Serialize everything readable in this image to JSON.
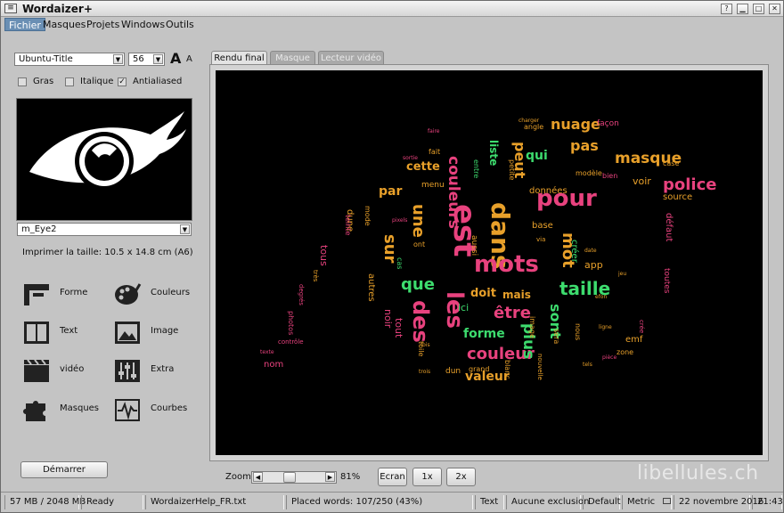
{
  "window": {
    "title": "Wordaizer+"
  },
  "menu": [
    "Fichier",
    "Masques",
    "Projets",
    "Windows",
    "Outils"
  ],
  "font": {
    "family": "Ubuntu-Title",
    "size": "56",
    "big_a": "A",
    "small_a": "A"
  },
  "options": {
    "bold": "Gras",
    "italic": "Italique",
    "antialiased": "Antialiased",
    "antialiased_checked": true
  },
  "mask": {
    "selected": "m_Eye2"
  },
  "print_size": "Imprimer la taille: 10.5 x 14.8 cm (A6)",
  "tools": [
    {
      "label": "Forme",
      "icon": "ruler-icon"
    },
    {
      "label": "Couleurs",
      "icon": "palette-icon"
    },
    {
      "label": "Text",
      "icon": "book-icon"
    },
    {
      "label": "Image",
      "icon": "picture-icon"
    },
    {
      "label": "vidéo",
      "icon": "clapper-icon"
    },
    {
      "label": "Extra",
      "icon": "sliders-icon"
    },
    {
      "label": "Masques",
      "icon": "puzzle-icon"
    },
    {
      "label": "Courbes",
      "icon": "waveform-icon"
    }
  ],
  "start_button": "Démarrer",
  "tabs": [
    {
      "label": "Rendu final",
      "active": true
    },
    {
      "label": "Masque",
      "active": false
    },
    {
      "label": "Lecteur vidéo",
      "active": false
    }
  ],
  "zoom": {
    "label": "Zoom",
    "value": "81%",
    "level_percent": 81
  },
  "view_buttons": [
    "Ecran",
    "1x",
    "2x"
  ],
  "watermark": "libellules.ch",
  "status": {
    "memory": "57 MB / 2048 MB",
    "state": "Ready",
    "file": "WordaizerHelp_FR.txt",
    "placed": "Placed words: 107/250 (43%)",
    "mode": "Text",
    "exclusion": "Aucune exclusion",
    "default": "Default",
    "unit": "Metric",
    "date": "22 novembre 2016",
    "time": "21:43"
  },
  "colors": {
    "pink": "#e8427e",
    "orange": "#e8a02a",
    "green": "#3ddc6e",
    "light": "#f2b9c6"
  },
  "cloud": [
    {
      "w": "est",
      "c": "pink",
      "s": 34,
      "r": 90
    },
    {
      "w": "dans",
      "c": "orange",
      "s": 28,
      "r": 90
    },
    {
      "w": "pour",
      "c": "pink",
      "s": 26,
      "r": 0
    },
    {
      "w": "mots",
      "c": "pink",
      "s": 26,
      "r": 0
    },
    {
      "w": "les",
      "c": "pink",
      "s": 26,
      "r": 90
    },
    {
      "w": "des",
      "c": "pink",
      "s": 24,
      "r": 90
    },
    {
      "w": "couleur",
      "c": "pink",
      "s": 18,
      "r": 0
    },
    {
      "w": "être",
      "c": "pink",
      "s": 18,
      "r": 0
    },
    {
      "w": "taille",
      "c": "green",
      "s": 20,
      "r": 0
    },
    {
      "w": "police",
      "c": "pink",
      "s": 18,
      "r": 0
    },
    {
      "w": "masque",
      "c": "orange",
      "s": 17,
      "r": 0
    },
    {
      "w": "nuage",
      "c": "orange",
      "s": 16,
      "r": 0
    },
    {
      "w": "pas",
      "c": "orange",
      "s": 16,
      "r": 0
    },
    {
      "w": "peut",
      "c": "orange",
      "s": 16,
      "r": 90
    },
    {
      "w": "couleurs",
      "c": "pink",
      "s": 17,
      "r": 90
    },
    {
      "w": "une",
      "c": "orange",
      "s": 18,
      "r": 90
    },
    {
      "w": "sur",
      "c": "orange",
      "s": 18,
      "r": 90
    },
    {
      "w": "que",
      "c": "green",
      "s": 18,
      "r": 0
    },
    {
      "w": "par",
      "c": "orange",
      "s": 14,
      "r": 0
    },
    {
      "w": "cette",
      "c": "orange",
      "s": 13,
      "r": 0
    },
    {
      "w": "mot",
      "c": "orange",
      "s": 18,
      "r": 90
    },
    {
      "w": "sont",
      "c": "green",
      "s": 16,
      "r": 90
    },
    {
      "w": "plus",
      "c": "green",
      "s": 17,
      "r": 90
    },
    {
      "w": "forme",
      "c": "green",
      "s": 14,
      "r": 0
    },
    {
      "w": "valeur",
      "c": "orange",
      "s": 14,
      "r": 0
    },
    {
      "w": "doit",
      "c": "orange",
      "s": 13,
      "r": 0
    },
    {
      "w": "mais",
      "c": "orange",
      "s": 12,
      "r": 0
    },
    {
      "w": "qui",
      "c": "green",
      "s": 14,
      "r": 0
    },
    {
      "w": "liste",
      "c": "green",
      "s": 12,
      "r": 90
    },
    {
      "w": "voir",
      "c": "orange",
      "s": 11,
      "r": 0
    },
    {
      "w": "source",
      "c": "orange",
      "s": 10,
      "r": 0
    },
    {
      "w": "défaut",
      "c": "pink",
      "s": 10,
      "r": 90
    },
    {
      "w": "toutes",
      "c": "pink",
      "s": 9,
      "r": 90
    },
    {
      "w": "tous",
      "c": "pink",
      "s": 11,
      "r": 90
    },
    {
      "w": "données",
      "c": "orange",
      "s": 10,
      "r": 0
    },
    {
      "w": "base",
      "c": "orange",
      "s": 10,
      "r": 0
    },
    {
      "w": "créer",
      "c": "green",
      "s": 10,
      "r": 90
    },
    {
      "w": "app",
      "c": "orange",
      "s": 11,
      "r": 0
    },
    {
      "w": "emf",
      "c": "orange",
      "s": 10,
      "r": 0
    },
    {
      "w": "nom",
      "c": "pink",
      "s": 10,
      "r": 0
    },
    {
      "w": "ici",
      "c": "green",
      "s": 11,
      "r": 0
    },
    {
      "w": "tout",
      "c": "pink",
      "s": 11,
      "r": 90
    },
    {
      "w": "noir",
      "c": "pink",
      "s": 11,
      "r": 90
    },
    {
      "w": "autres",
      "c": "orange",
      "s": 10,
      "r": 90
    },
    {
      "w": "dune",
      "c": "orange",
      "s": 10,
      "r": 90
    },
    {
      "w": "menu",
      "c": "orange",
      "s": 9,
      "r": 0
    },
    {
      "w": "aussi",
      "c": "orange",
      "s": 9,
      "r": 90
    },
    {
      "w": "case",
      "c": "orange",
      "s": 8,
      "r": 0
    },
    {
      "w": "fait",
      "c": "orange",
      "s": 8,
      "r": 0
    },
    {
      "w": "dun",
      "c": "orange",
      "s": 9,
      "r": 0
    },
    {
      "w": "grand",
      "c": "orange",
      "s": 8,
      "r": 0
    },
    {
      "w": "zone",
      "c": "orange",
      "s": 8,
      "r": 0
    },
    {
      "w": "modèle",
      "c": "orange",
      "s": 8,
      "r": 0
    },
    {
      "w": "façon",
      "c": "pink",
      "s": 9,
      "r": 0
    },
    {
      "w": "photos",
      "c": "pink",
      "s": 8,
      "r": 90
    },
    {
      "w": "contrôle",
      "c": "pink",
      "s": 7,
      "r": 0
    },
    {
      "w": "degrés",
      "c": "pink",
      "s": 7,
      "r": 90
    },
    {
      "w": "teinte",
      "c": "pink",
      "s": 8,
      "r": 90
    },
    {
      "w": "mode",
      "c": "orange",
      "s": 8,
      "r": 90
    },
    {
      "w": "angle",
      "c": "orange",
      "s": 8,
      "r": 0
    },
    {
      "w": "petite",
      "c": "orange",
      "s": 8,
      "r": 90
    },
    {
      "w": "image",
      "c": "orange",
      "s": 8,
      "r": 90
    },
    {
      "w": "blanc",
      "c": "orange",
      "s": 8,
      "r": 90
    },
    {
      "w": "toile",
      "c": "orange",
      "s": 8,
      "r": 90
    },
    {
      "w": "nouvelle",
      "c": "orange",
      "s": 7,
      "r": 90
    },
    {
      "w": "bien",
      "c": "pink",
      "s": 8,
      "r": 0
    },
    {
      "w": "entre",
      "c": "green",
      "s": 8,
      "r": 90
    },
    {
      "w": "sera",
      "c": "orange",
      "s": 8,
      "r": 90
    },
    {
      "w": "nous",
      "c": "orange",
      "s": 8,
      "r": 90
    },
    {
      "w": "cas",
      "c": "green",
      "s": 8,
      "r": 90
    },
    {
      "w": "ont",
      "c": "orange",
      "s": 8,
      "r": 0
    },
    {
      "w": "via",
      "c": "orange",
      "s": 7,
      "r": 0
    },
    {
      "w": "charger",
      "c": "orange",
      "s": 6,
      "r": 0
    },
    {
      "w": "faire",
      "c": "pink",
      "s": 6,
      "r": 0
    },
    {
      "w": "sortie",
      "c": "pink",
      "s": 6,
      "r": 0
    },
    {
      "w": "très",
      "c": "orange",
      "s": 7,
      "r": 90
    },
    {
      "w": "pixels",
      "c": "pink",
      "s": 6,
      "r": 0
    },
    {
      "w": "texte",
      "c": "pink",
      "s": 6,
      "r": 0
    },
    {
      "w": "fois",
      "c": "orange",
      "s": 6,
      "r": 0
    },
    {
      "w": "ligne",
      "c": "orange",
      "s": 6,
      "r": 0
    },
    {
      "w": "pièce",
      "c": "pink",
      "s": 6,
      "r": 0
    },
    {
      "w": "crée",
      "c": "pink",
      "s": 7,
      "r": 90
    },
    {
      "w": "trois",
      "c": "orange",
      "s": 6,
      "r": 0
    },
    {
      "w": "tels",
      "c": "orange",
      "s": 6,
      "r": 0
    },
    {
      "w": "date",
      "c": "orange",
      "s": 6,
      "r": 0
    },
    {
      "w": "efon",
      "c": "orange",
      "s": 6,
      "r": 0
    },
    {
      "w": "jeu",
      "c": "orange",
      "s": 6,
      "r": 0
    }
  ]
}
